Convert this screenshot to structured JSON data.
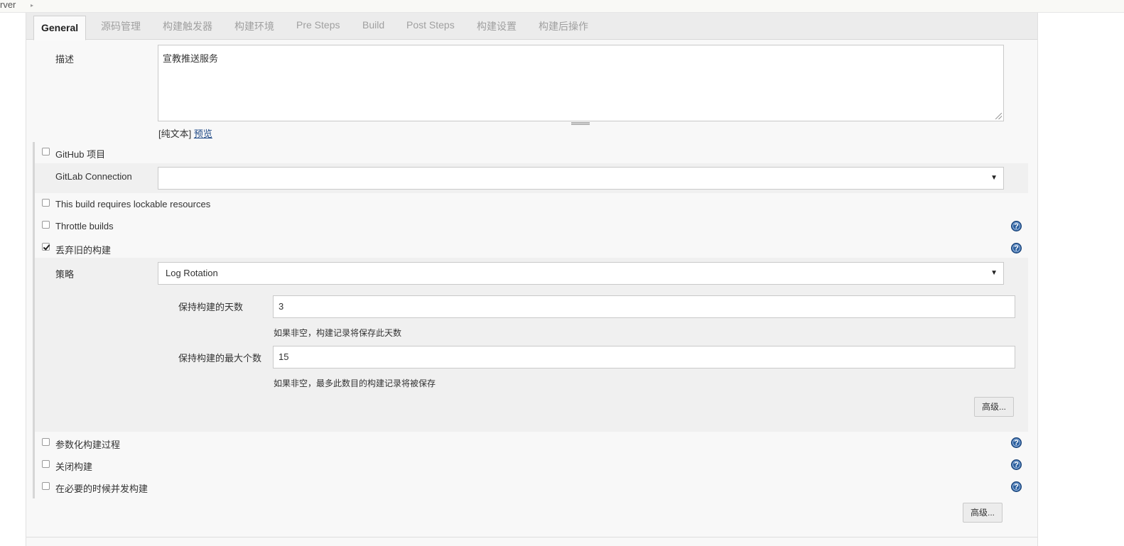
{
  "breadcrumb": {
    "text": "rver"
  },
  "tabs": [
    {
      "label": "General"
    },
    {
      "label": "源码管理"
    },
    {
      "label": "构建触发器"
    },
    {
      "label": "构建环境"
    },
    {
      "label": "Pre Steps"
    },
    {
      "label": "Build"
    },
    {
      "label": "Post Steps"
    },
    {
      "label": "构建设置"
    },
    {
      "label": "构建后操作"
    }
  ],
  "description": {
    "label": "描述",
    "value": "宣教推送服务",
    "format_plain": "[纯文本]",
    "preview_link": "预览"
  },
  "options": {
    "github_project": "GitHub 项目",
    "gitlab_connection_label": "GitLab Connection",
    "gitlab_connection_value": "",
    "lockable_resources": "This build requires lockable resources",
    "throttle_builds": "Throttle builds",
    "discard_old_builds": "丢弃旧的构建",
    "parameterized": "参数化构建过程",
    "disable_build": "关闭构建",
    "concurrent_build": "在必要的时候并发构建"
  },
  "strategy": {
    "label": "策略",
    "value": "Log Rotation",
    "days_label": "保持构建的天数",
    "days_value": "3",
    "days_hint": "如果非空，构建记录将保存此天数",
    "max_label": "保持构建的最大个数",
    "max_value": "15",
    "max_hint": "如果非空，最多此数目的构建记录将被保存",
    "advanced_button": "高级..."
  },
  "footer": {
    "advanced_button": "高级..."
  },
  "icons": {
    "help": "help-icon",
    "dropdown": "chevron-down-icon"
  },
  "colors": {
    "help_icon": "#2b5f9e",
    "tab_bar": "#ececec",
    "panel": "#f8f8f8"
  }
}
